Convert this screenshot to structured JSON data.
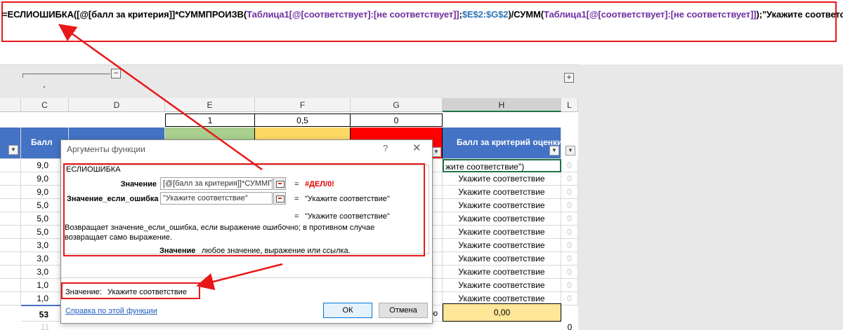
{
  "formula": {
    "parts": [
      "=ЕСЛИОШИБКА([@[балл за критерия]]*СУММПРОИЗВ(",
      "Таблица1[@[соответствует]:[не соответствует]]",
      ";",
      "$E$2:$G$2",
      ")/СУММ(",
      "Таблица1[@[соответствует]:[не соответствует]]",
      ");\"Укажите соответствие\")"
    ]
  },
  "outline": {
    "minus": "−",
    "plus": "+"
  },
  "columns": [
    "C",
    "D",
    "E",
    "F",
    "G",
    "H",
    "L"
  ],
  "weights": {
    "e": "1",
    "f": "0,5",
    "g": "0"
  },
  "colors": {
    "green": "#a9d08e",
    "yellow": "#ffd966",
    "red": "#ff0000",
    "header_blue": "#4472c4",
    "total_yellow": "#ffe699"
  },
  "header": {
    "c_label": "Балл",
    "h_label": "Балл за критерий оценки"
  },
  "rows": [
    {
      "score": "9,0",
      "h": "жите соответствие\")",
      "l": "0"
    },
    {
      "score": "9,0",
      "h": "Укажите соответствие",
      "l": "0"
    },
    {
      "score": "9,0",
      "h": "Укажите соответствие",
      "l": "0"
    },
    {
      "score": "5,0",
      "h": "Укажите соответствие",
      "l": "0"
    },
    {
      "score": "5,0",
      "h": "Укажите соответствие",
      "l": "0"
    },
    {
      "score": "5,0",
      "h": "Укажите соответствие",
      "l": "0"
    },
    {
      "score": "3,0",
      "h": "Укажите соответствие",
      "l": "0"
    },
    {
      "score": "3,0",
      "h": "Укажите соответствие",
      "l": "0"
    },
    {
      "score": "3,0",
      "h": "Укажите соответствие",
      "l": "0"
    },
    {
      "score": "1,0",
      "h": "Укажите соответствие",
      "l": "0"
    },
    {
      "score": "1,0",
      "h": "Укажите соответствие",
      "l": "0"
    }
  ],
  "total": {
    "score": "53",
    "partial": "ю",
    "h": "0,00",
    "next_row": "11",
    "l_bottom": "0"
  },
  "dialog": {
    "title": "Аргументы функции",
    "help_icon": "?",
    "close_icon": "✕",
    "function_name": "ЕСЛИОШИБКА",
    "arg1_label": "Значение",
    "arg1_value": "[@[балл за критерия]]*СУММП",
    "arg1_result": "#ДЕЛ/0!",
    "arg2_label": "Значение_если_ошибка",
    "arg2_value": "\"Укажите соответствие\"",
    "arg2_result": "\"Укажите соответствие\"",
    "eq": "=",
    "overall_result": "\"Укажите соответствие\"",
    "description": "Возвращает значение_если_ошибка, если выражение ошибочно; в противном случае возвращает само выражение.",
    "param_name": "Значение",
    "param_desc": "любое значение, выражение или ссылка.",
    "value_label": "Значение:",
    "value_result": "Укажите соответствие",
    "help_link": "Справка по этой функции",
    "ok": "ОК",
    "cancel": "Отмена"
  }
}
